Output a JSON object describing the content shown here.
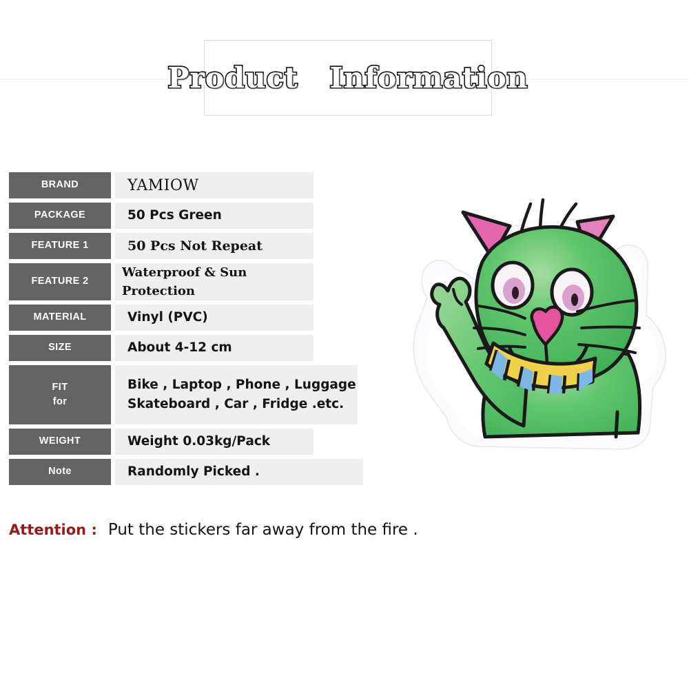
{
  "header": {
    "title": "Product   Information"
  },
  "spec_table": {
    "rows": [
      {
        "label": "BRAND",
        "label2": "",
        "value": "YAMIOW",
        "value2": ""
      },
      {
        "label": "PACKAGE",
        "label2": "",
        "value": "50 Pcs Green",
        "value2": ""
      },
      {
        "label": "FEATURE 1",
        "label2": "",
        "value": "50 Pcs Not Repeat",
        "value2": ""
      },
      {
        "label": "FEATURE 2",
        "label2": "",
        "value": "Waterproof & Sun Protection",
        "value2": ""
      },
      {
        "label": "MATERIAL",
        "label2": "",
        "value": "Vinyl (PVC)",
        "value2": ""
      },
      {
        "label": "SIZE",
        "label2": "",
        "value": "About 4-12 cm",
        "value2": ""
      },
      {
        "label": "FIT",
        "label2": "for",
        "value": "Bike , Laptop , Phone , Luggage",
        "value2": "Skateboard , Car , Fridge .etc."
      },
      {
        "label": "WEIGHT",
        "label2": "",
        "value": "Weight 0.03kg/Pack",
        "value2": ""
      },
      {
        "label": "Note",
        "label2": "",
        "value": "Randomly Picked .",
        "value2": ""
      }
    ]
  },
  "attention": {
    "label": "Attention :",
    "text": "Put the stickers far away from the fire ."
  },
  "sticker": {
    "name": "green-cat-sticker",
    "description": "Hand-drawn green cat sticker waving one paw, with striped collar",
    "colors": {
      "body_green": "#5cc46a",
      "body_green_light": "#8fd490",
      "outline_black": "#1a1a1a",
      "ear_pink": "#e05fa8",
      "nose_pink": "#e0559b",
      "eye_white": "#f7f2f6",
      "iris_pink": "#d9a3cd",
      "collar_yellow": "#f0d24a",
      "collar_blue": "#7fb6e8",
      "die_cut_white": "#fbfafc"
    }
  },
  "theme": {
    "label_bg": "#636363",
    "value_bg": "#efeff0",
    "page_bg": "#ffffff",
    "attention_red": "#9e1915",
    "rule_gray": "#e2e0e1"
  }
}
